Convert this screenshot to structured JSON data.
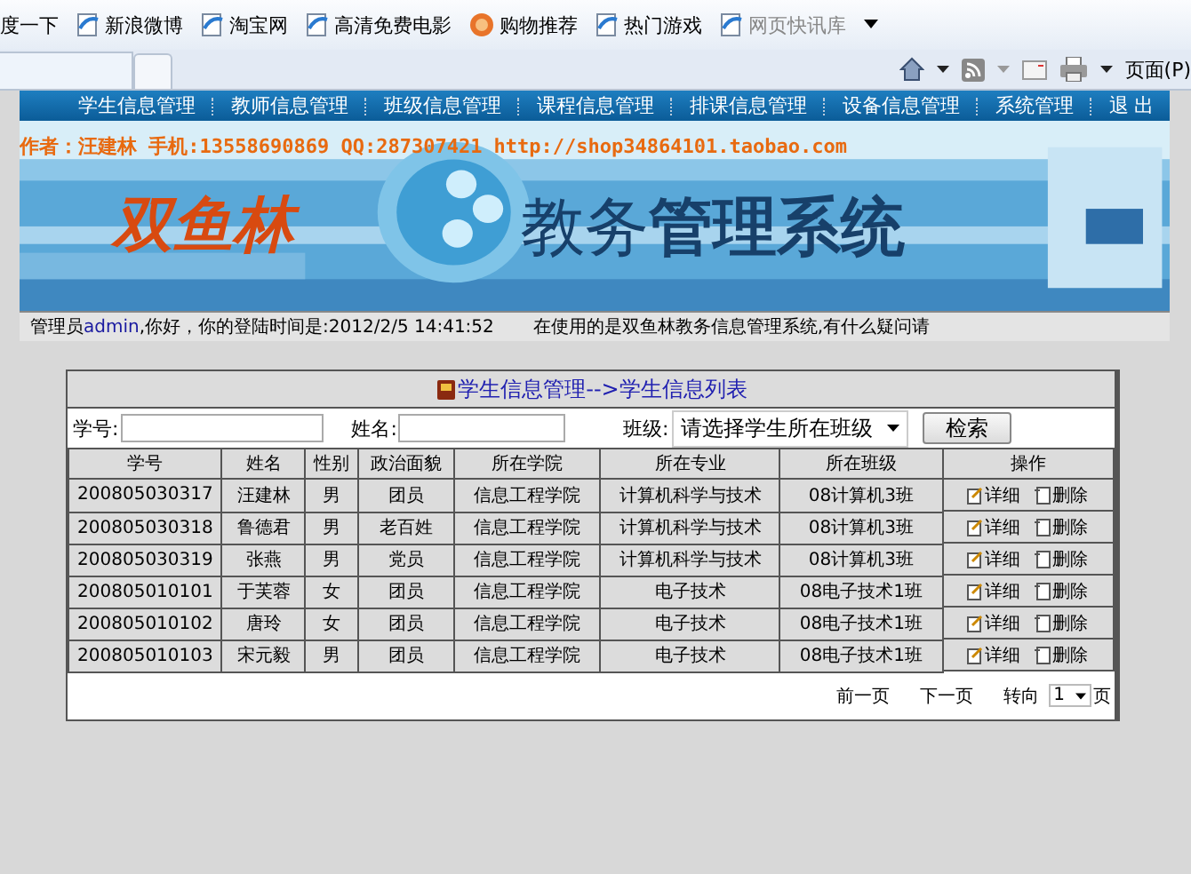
{
  "favorites": [
    {
      "label": "度一下",
      "kind": "plain",
      "disabled": false
    },
    {
      "label": "新浪微博",
      "kind": "page",
      "disabled": false
    },
    {
      "label": "淘宝网",
      "kind": "page",
      "disabled": false
    },
    {
      "label": "高清免费电影",
      "kind": "page",
      "disabled": false
    },
    {
      "label": "购物推荐",
      "kind": "coin",
      "disabled": false
    },
    {
      "label": "热门游戏",
      "kind": "page",
      "disabled": false
    },
    {
      "label": "网页快讯库",
      "kind": "page",
      "disabled": true
    }
  ],
  "toolbar": {
    "page_menu": "页面(P)"
  },
  "nav": [
    "学生信息管理",
    "教师信息管理",
    "班级信息管理",
    "课程信息管理",
    "排课信息管理",
    "设备信息管理",
    "系统管理",
    "退 出"
  ],
  "banner": {
    "author": "作者：汪建林  手机:13558690869 QQ:287307421 http://shop34864101.taobao.com",
    "brand": "双鱼林",
    "title_light": "教务",
    "title_bold": "管理系统"
  },
  "info": {
    "welcome_prefix": "管理员",
    "user": "admin",
    "welcome_suffix": ",你好，你的登陆时间是:2012/2/5 14:41:52",
    "notice": "在使用的是双鱼林教务信息管理系统,有什么疑问请"
  },
  "panel": {
    "title": "学生信息管理-->学生信息列表",
    "filters": {
      "id_label": "学号:",
      "name_label": "姓名:",
      "class_label": "班级:",
      "class_select": "请选择学生所在班级",
      "search_button": "检索"
    },
    "columns": [
      "学号",
      "姓名",
      "性别",
      "政治面貌",
      "所在学院",
      "所在专业",
      "所在班级",
      "操作"
    ],
    "rows": [
      {
        "cells": [
          "200805030317",
          "汪建林",
          "男",
          "团员",
          "信息工程学院",
          "计算机科学与技术",
          "08计算机3班"
        ],
        "actions": [
          "详细",
          "删除"
        ]
      },
      {
        "cells": [
          "200805030318",
          "鲁德君",
          "男",
          "老百姓",
          "信息工程学院",
          "计算机科学与技术",
          "08计算机3班"
        ],
        "actions": [
          "详细",
          "删除"
        ]
      },
      {
        "cells": [
          "200805030319",
          "张燕",
          "男",
          "党员",
          "信息工程学院",
          "计算机科学与技术",
          "08计算机3班"
        ],
        "actions": [
          "详细",
          "删除"
        ]
      },
      {
        "cells": [
          "200805010101",
          "于芙蓉",
          "女",
          "团员",
          "信息工程学院",
          "电子技术",
          "08电子技术1班"
        ],
        "actions": [
          "详细",
          "删除"
        ]
      },
      {
        "cells": [
          "200805010102",
          "唐玲",
          "女",
          "团员",
          "信息工程学院",
          "电子技术",
          "08电子技术1班"
        ],
        "actions": [
          "详细",
          "删除"
        ]
      },
      {
        "cells": [
          "200805010103",
          "宋元毅",
          "男",
          "团员",
          "信息工程学院",
          "电子技术",
          "08电子技术1班"
        ],
        "actions": [
          "详细",
          "删除"
        ]
      }
    ],
    "pager": {
      "prev": "前一页",
      "next": "下一页",
      "goto": "转向",
      "page": "1",
      "unit": "页"
    }
  }
}
